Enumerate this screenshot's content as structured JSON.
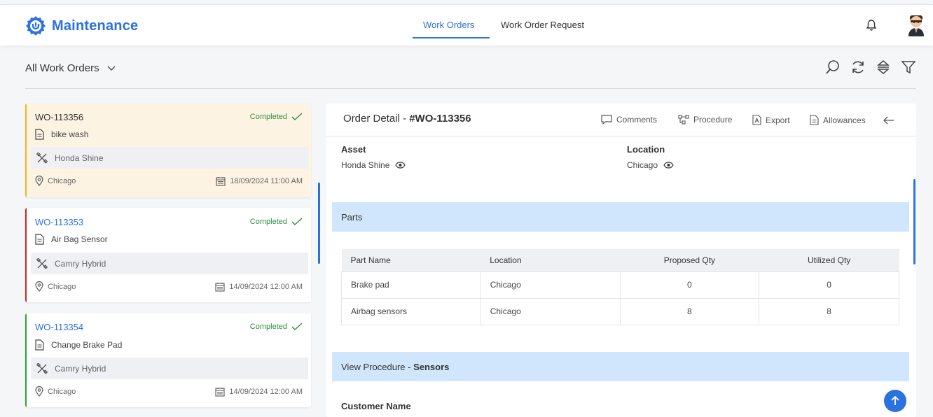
{
  "app": {
    "title": "Maintenance"
  },
  "nav": {
    "tabs": [
      {
        "label": "Work Orders",
        "active": true
      },
      {
        "label": "Work Order Request",
        "active": false
      }
    ]
  },
  "list": {
    "filter_label": "All Work Orders",
    "cards": [
      {
        "id": "WO-113356",
        "status": "Completed",
        "title": "bike wash",
        "asset": "Honda Shine",
        "location": "Chicago",
        "date": "18/09/2024 11:00 AM",
        "selected": true,
        "stripe_color": "#f0b429"
      },
      {
        "id": "WO-113353",
        "status": "Completed",
        "title": "Air Bag Sensor",
        "asset": "Camry Hybrid",
        "location": "Chicago",
        "date": "14/09/2024 12:00 AM",
        "selected": false,
        "stripe_color": "#c62828"
      },
      {
        "id": "WO-113354",
        "status": "Completed",
        "title": "Change Brake Pad",
        "asset": "Camry Hybrid",
        "location": "Chicago",
        "date": "14/09/2024 12:00 AM",
        "selected": false,
        "stripe_color": "#2e9e44"
      }
    ]
  },
  "detail": {
    "title_prefix": "Order Detail - ",
    "title_id": "#WO-113356",
    "actions": {
      "comments": "Comments",
      "procedure": "Procedure",
      "export": "Export",
      "allowances": "Allowances"
    },
    "asset_label": "Asset",
    "asset_value": "Honda Shine",
    "location_label": "Location",
    "location_value": "Chicago",
    "parts_header": "Parts",
    "parts_table": {
      "columns": [
        "Part Name",
        "Location",
        "Proposed Qty",
        "Utilized Qty"
      ],
      "rows": [
        [
          "Brake pad",
          "Chicago",
          "0",
          "0"
        ],
        [
          "Airbag sensors",
          "Chicago",
          "8",
          "8"
        ]
      ]
    },
    "procedure_header_prefix": "View Procedure - ",
    "procedure_header_name": "Sensors",
    "customer_name_label": "Customer Name"
  },
  "colors": {
    "accent": "#2a72de",
    "status_green": "#2f8f3f",
    "section_band": "#cfe6fc",
    "selected_card_bg": "#fdf3e3"
  }
}
